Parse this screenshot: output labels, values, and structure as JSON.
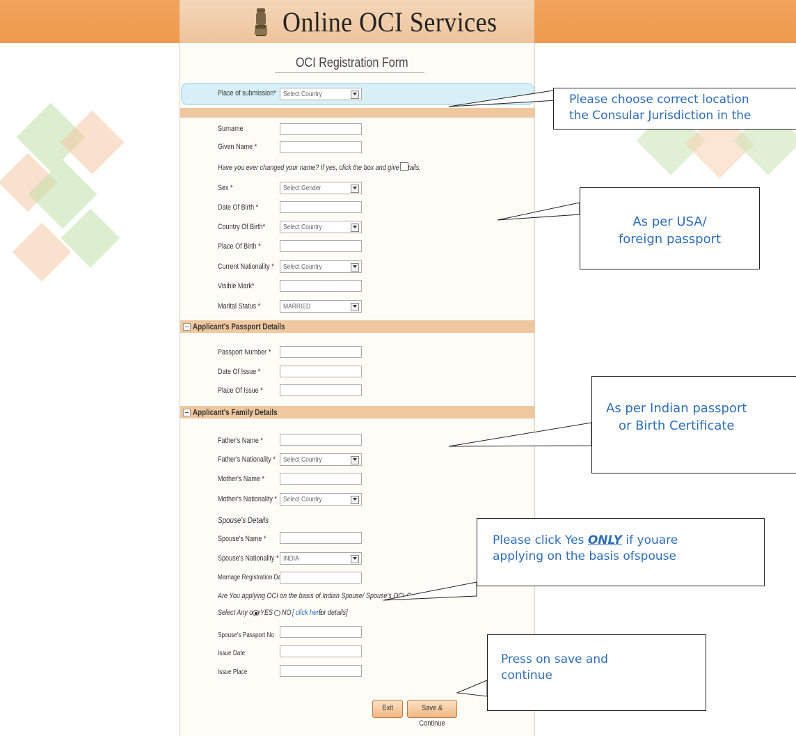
{
  "header": {
    "title": "Online OCI Services",
    "emblem_icon": "india-emblem-icon"
  },
  "form": {
    "title": "OCI Registration Form",
    "place_of_submission": {
      "label": "Place of submission*",
      "value": "Select Country"
    },
    "surname": {
      "label": "Surname",
      "value": ""
    },
    "given_name": {
      "label": "Given Name *",
      "value": ""
    },
    "name_changed_question": "Have you ever changed your name? If yes, click the box and give details.",
    "sex": {
      "label": "Sex *",
      "value": "Select Gender"
    },
    "dob": {
      "label": "Date Of Birth *",
      "value": ""
    },
    "country_of_birth": {
      "label": "Country Of Birth*",
      "value": "Select Country"
    },
    "place_of_birth": {
      "label": "Place Of Birth *",
      "value": ""
    },
    "current_nationality": {
      "label": "Current Nationality *",
      "value": "Select Country"
    },
    "visible_mark": {
      "label": "Visible Mark*",
      "value": ""
    },
    "marital_status": {
      "label": "Marital Status *",
      "value": "MARRIED"
    },
    "passport_section": {
      "title": "Applicant's Passport Details",
      "passport_number": "Passport Number *",
      "date_of_issue": "Date Of Issue *",
      "place_of_issue": "Place Of Issue *"
    },
    "family_section": {
      "title": "Applicant's Family Details",
      "fathers_name": "Father's Name *",
      "fathers_nationality": {
        "label": "Father's Nationality *",
        "value": "Select Country"
      },
      "mothers_name": "Mother's Name *",
      "mothers_nationality": {
        "label": "Mother's Nationality *",
        "value": "Select Country"
      },
      "spouse_details": "Spouse's Details",
      "spouse_name": "Spouse's Name *",
      "spouse_nationality": {
        "label": "Spouse's Nationality *",
        "value": "INDIA"
      },
      "marriage_registration_date": "Marriage Registration Date",
      "applying_question": "Are You applying OCI on the basis of Indian Spouse/ Spouse's OCI-Card?",
      "select_any_one": "Select Any one",
      "yes_label": "YES",
      "no_label": "NO",
      "details_link_open": "[",
      "details_link": "click here",
      "details_link_suffix": "for details]",
      "spouse_passport_no": "Spouse's Passport No",
      "issue_date": "Issue Date",
      "issue_place": "Issue Place"
    },
    "buttons": {
      "exit": "Exit",
      "save_continue": "Save & Continue"
    }
  },
  "callouts": {
    "location": {
      "line1": "Please choose correct location",
      "line2": "the Consular Jurisdiction in the"
    },
    "passport": {
      "line1": "As per USA/",
      "line2": "foreign passport"
    },
    "indian": {
      "line1": "As per Indian passport",
      "line2": "or Birth Certificate"
    },
    "spouse": {
      "line1_pre": "Please click Yes ",
      "line1_em": "ONLY",
      "line1_post": " if youare",
      "line2": "applying on the basis ofspouse"
    },
    "save": {
      "line1": "Press on save and",
      "line2": "continue"
    }
  },
  "colors": {
    "header": "#ee9a4e",
    "section_band": "#efc89f",
    "callout_text": "#2e6db4",
    "highlight_row": "#d8eff8"
  }
}
